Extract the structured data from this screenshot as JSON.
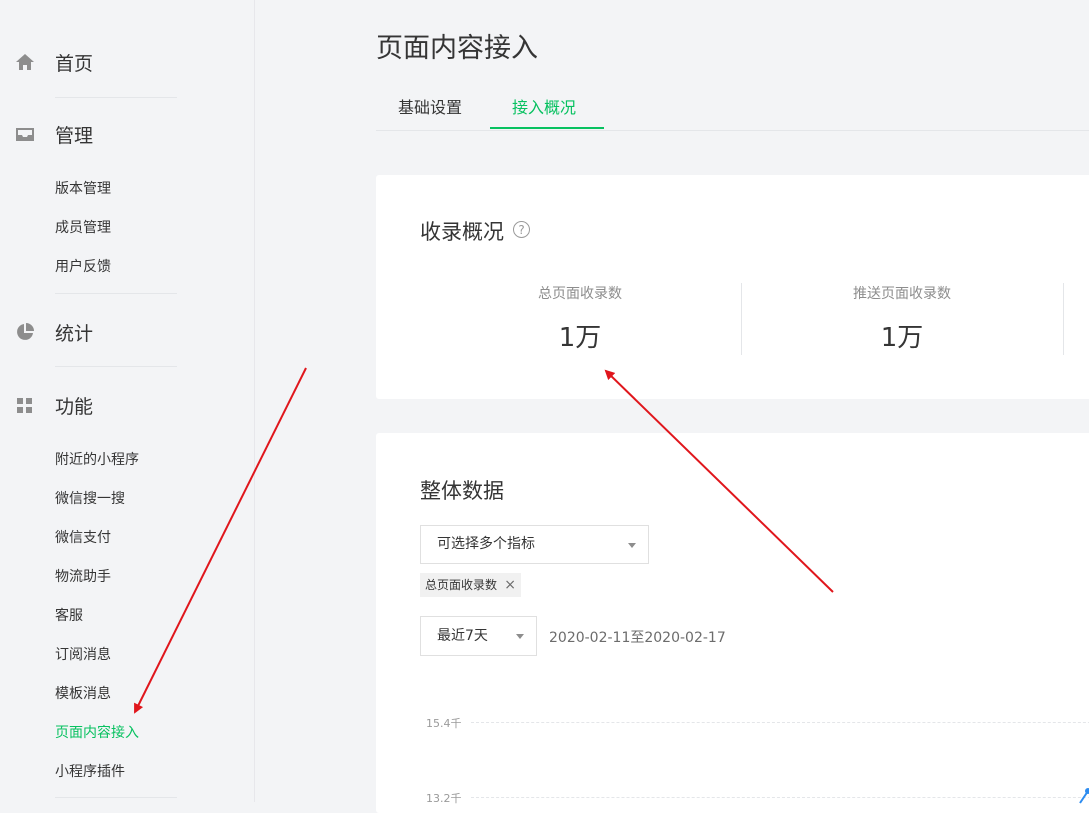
{
  "sidebar": {
    "home": {
      "label": "首页",
      "icon": "home-icon"
    },
    "manage": {
      "label": "管理",
      "icon": "inbox-icon",
      "items": [
        "版本管理",
        "成员管理",
        "用户反馈"
      ]
    },
    "stats": {
      "label": "统计",
      "icon": "pie-chart-icon"
    },
    "features": {
      "label": "功能",
      "icon": "grid-icon",
      "items": [
        "附近的小程序",
        "微信搜一搜",
        "微信支付",
        "物流助手",
        "客服",
        "订阅消息",
        "模板消息",
        "页面内容接入",
        "小程序插件"
      ],
      "active_index": 7
    }
  },
  "page": {
    "title": "页面内容接入",
    "tabs": [
      "基础设置",
      "接入概况"
    ],
    "active_tab": 1
  },
  "overview": {
    "title": "收录概况",
    "help": "?",
    "stats": [
      {
        "label": "总页面收录数",
        "value": "1万"
      },
      {
        "label": "推送页面收录数",
        "value": "1万"
      }
    ]
  },
  "overall": {
    "title": "整体数据",
    "metric_select_placeholder": "可选择多个指标",
    "selected_tag": "总页面收录数",
    "tag_close": "×",
    "range_select": "最近7天",
    "date_range": "2020-02-11至2020-02-17",
    "y_ticks": [
      "15.4千",
      "13.2千"
    ]
  },
  "colors": {
    "accent": "#07c160",
    "annotation": "#e0161c",
    "line": "#2d8cf0"
  }
}
